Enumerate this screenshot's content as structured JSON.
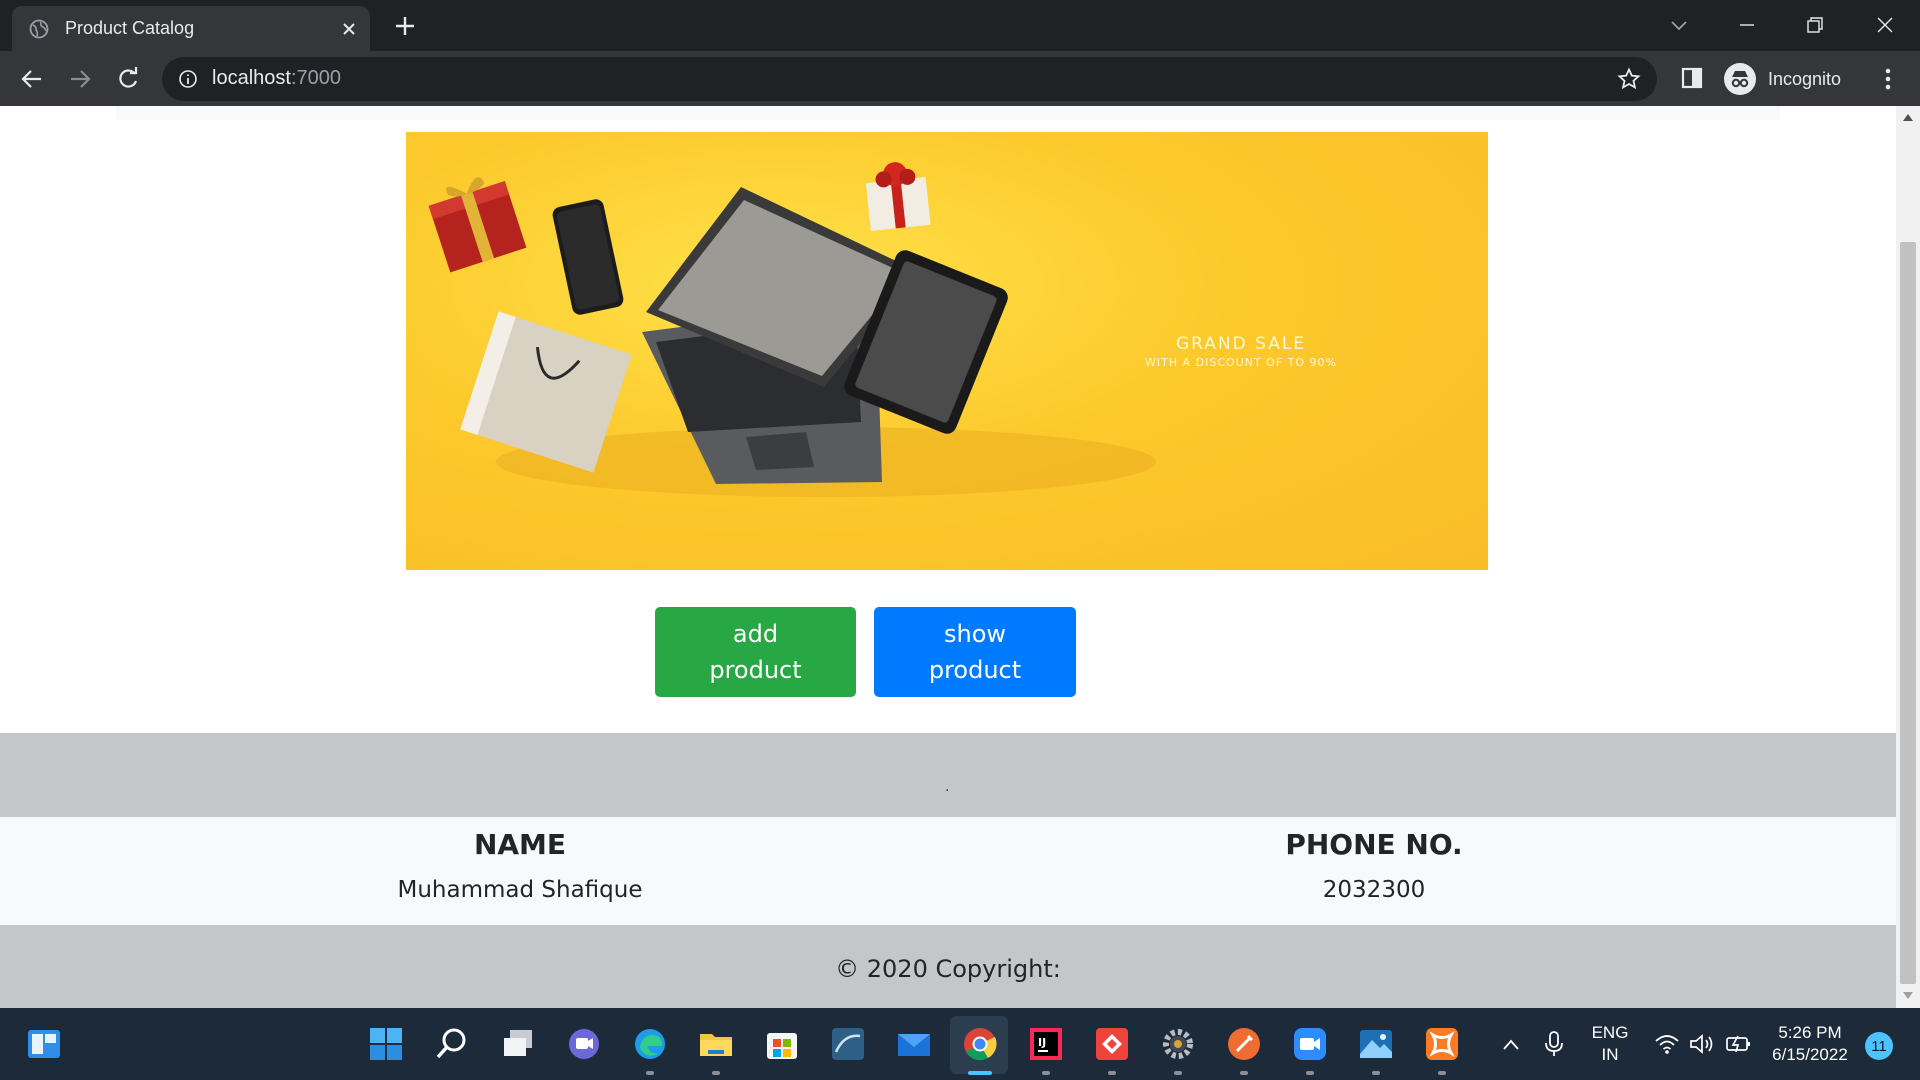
{
  "browser": {
    "tab_title": "Product Catalog",
    "url_host": "localhost",
    "url_port": ":7000",
    "profile_label": "Incognito"
  },
  "banner": {
    "headline": "GRAND SALE",
    "subline": "WITH A DISCOUNT OF TO 90%"
  },
  "buttons": {
    "add_line1": "add",
    "add_line2": "product",
    "show_line1": "show",
    "show_line2": "product"
  },
  "footer": {
    "dot": ".",
    "name_heading": "NAME",
    "name_value": "Muhammad Shafique",
    "phone_heading": "PHONE NO.",
    "phone_value": "2032300",
    "copyright": "© 2020 Copyright:"
  },
  "taskbar": {
    "lang_line1": "ENG",
    "lang_line2": "IN",
    "time": "5:26 PM",
    "date": "6/15/2022",
    "notification_count": "11"
  },
  "colors": {
    "add_button": "#28a745",
    "show_button": "#007bff",
    "banner_yellow": "#fcc92c",
    "footer_grey": "#c5c6c9"
  }
}
